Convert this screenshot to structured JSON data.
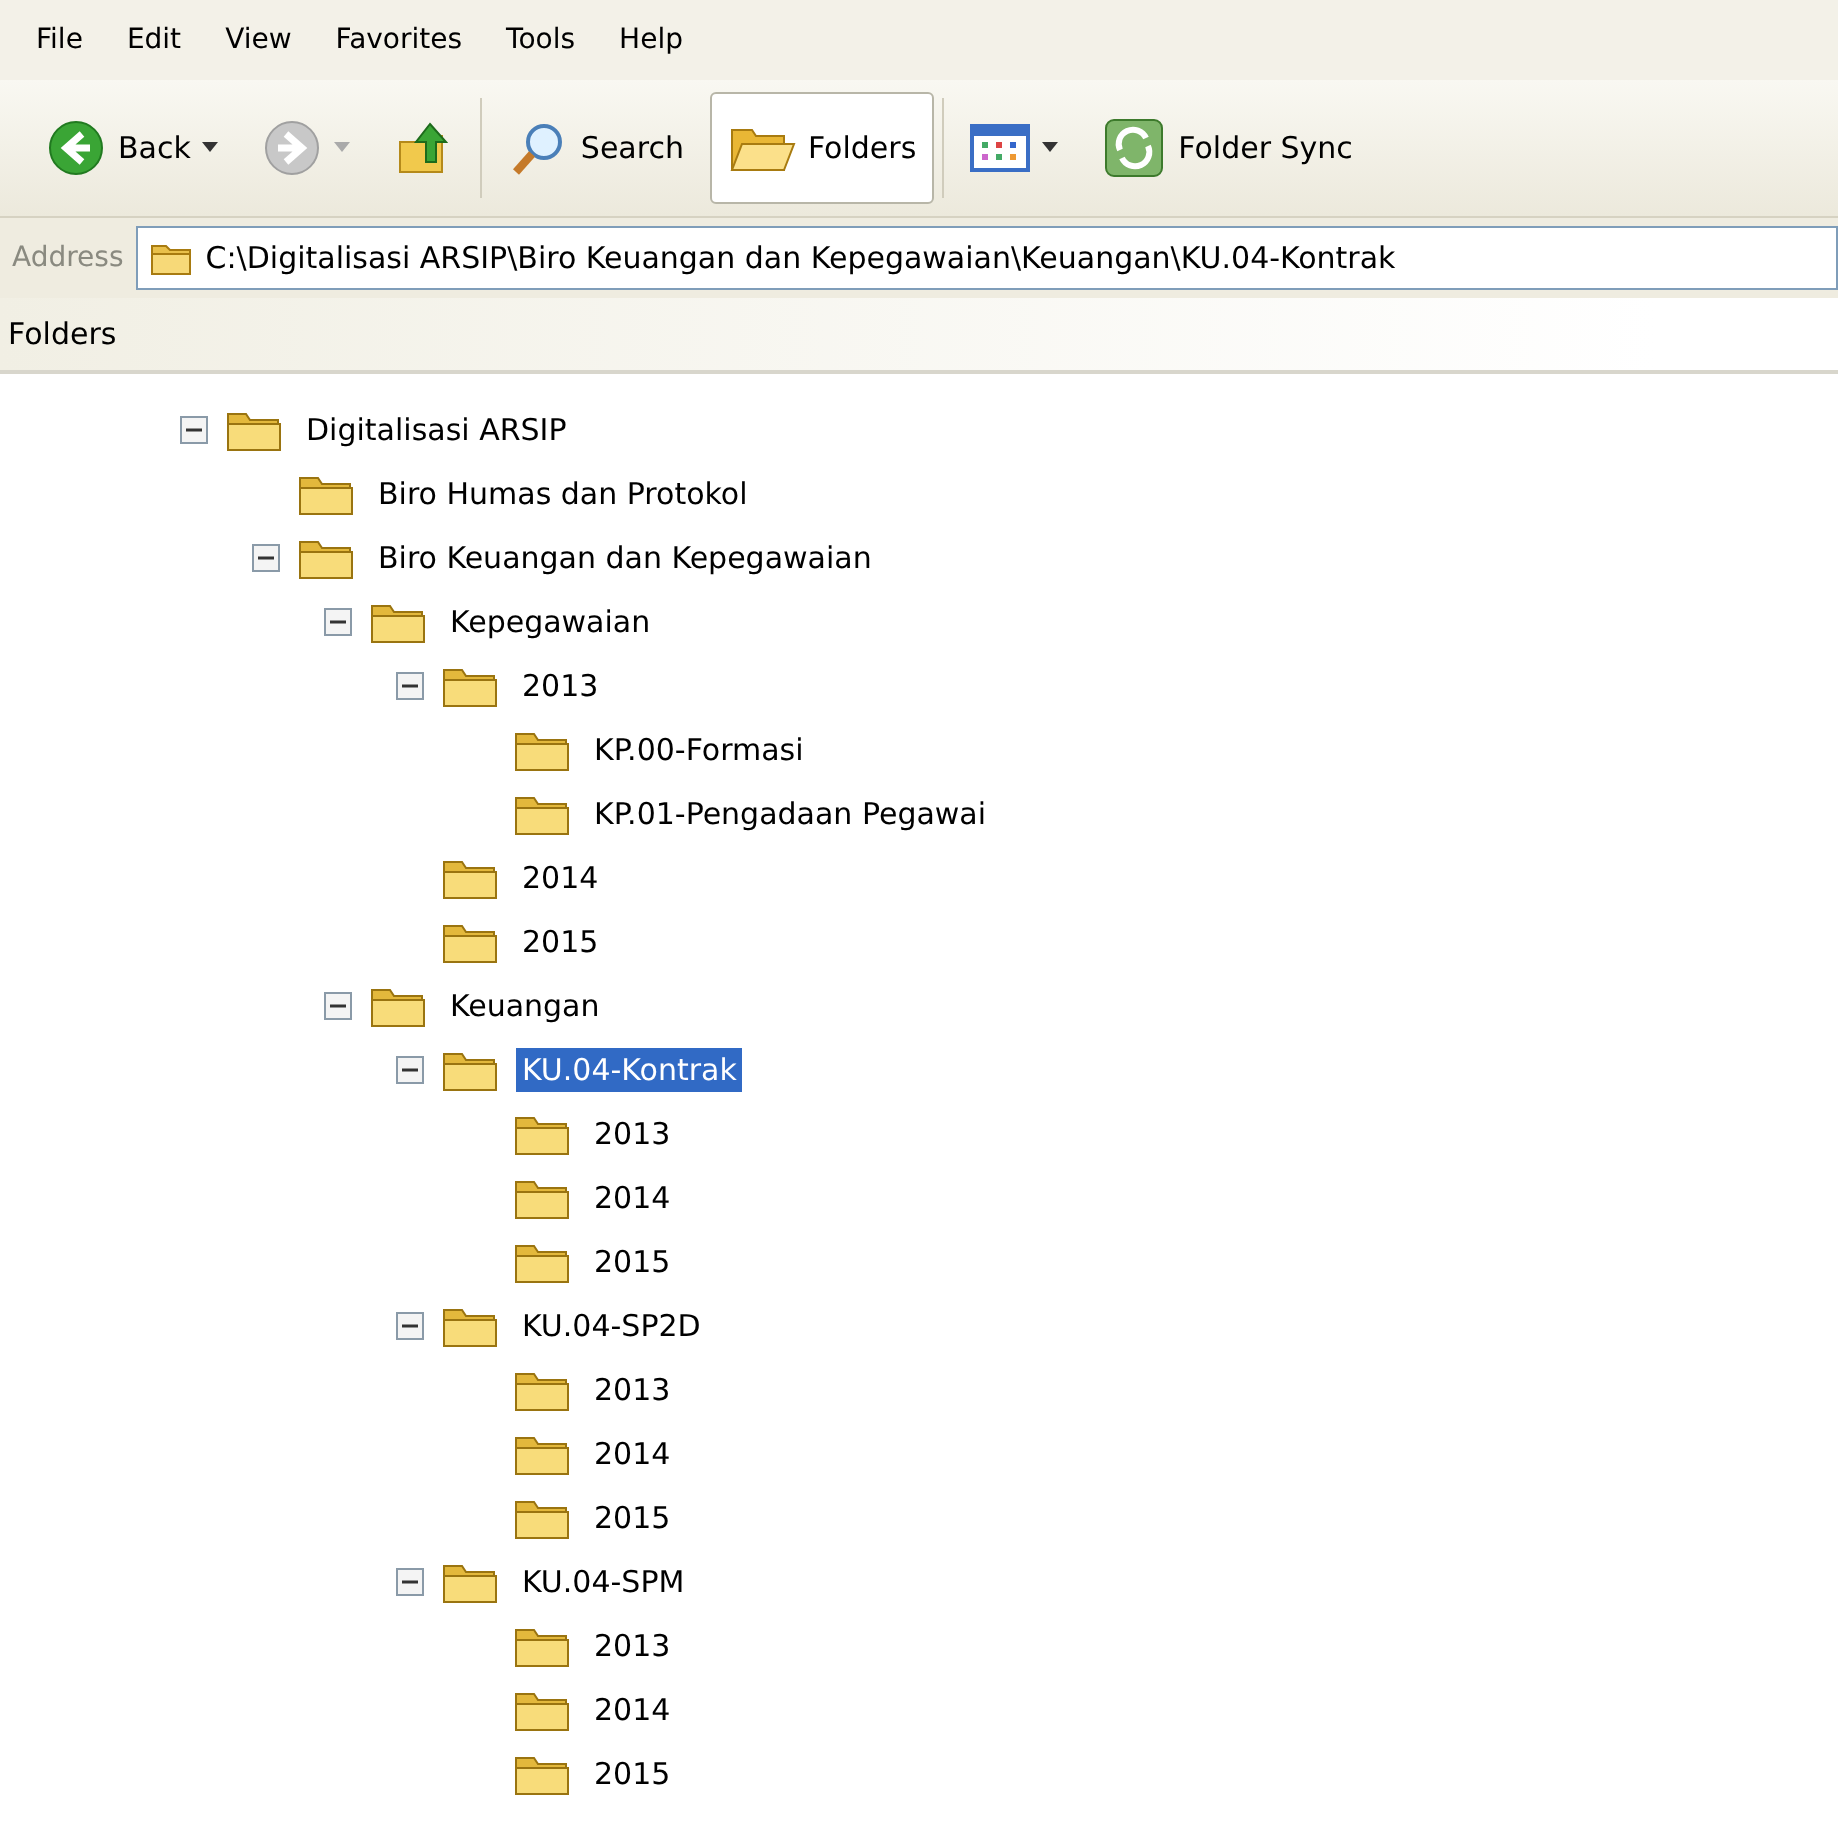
{
  "menu": [
    "File",
    "Edit",
    "View",
    "Favorites",
    "Tools",
    "Help"
  ],
  "toolbar": [
    {
      "kind": "back",
      "label": "Back",
      "disabled": false,
      "selected": false
    },
    {
      "kind": "forward",
      "disabled": true,
      "selected": false
    },
    {
      "kind": "up",
      "disabled": false,
      "selected": false
    },
    {
      "kind": "search",
      "label": "Search",
      "disabled": false,
      "selected": false
    },
    {
      "kind": "folders",
      "label": "Folders",
      "disabled": false,
      "selected": true
    },
    {
      "kind": "views",
      "disabled": false,
      "selected": false
    },
    {
      "kind": "sync",
      "label": "Folder Sync",
      "disabled": false,
      "selected": false
    }
  ],
  "address": {
    "label": "Address",
    "value": "C:\\Digitalisasi ARSIP\\Biro Keuangan dan Kepegawaian\\Keuangan\\KU.04-Kontrak"
  },
  "folders_pane": {
    "title": "Folders",
    "tree": [
      {
        "label": "Digitalisasi ARSIP",
        "expanded": true,
        "selected": false,
        "children": [
          {
            "label": "Biro Humas dan Protokol",
            "selected": false
          },
          {
            "label": "Biro Keuangan dan Kepegawaian",
            "expanded": true,
            "selected": false,
            "children": [
              {
                "label": "Kepegawaian",
                "expanded": true,
                "selected": false,
                "children": [
                  {
                    "label": "2013",
                    "expanded": true,
                    "selected": false,
                    "children": [
                      {
                        "label": "KP.00-Formasi",
                        "selected": false
                      },
                      {
                        "label": "KP.01-Pengadaan Pegawai",
                        "selected": false
                      }
                    ]
                  },
                  {
                    "label": "2014",
                    "selected": false
                  },
                  {
                    "label": "2015",
                    "selected": false
                  }
                ]
              },
              {
                "label": "Keuangan",
                "expanded": true,
                "selected": false,
                "children": [
                  {
                    "label": "KU.04-Kontrak",
                    "expanded": true,
                    "selected": true,
                    "children": [
                      {
                        "label": "2013",
                        "selected": false
                      },
                      {
                        "label": "2014",
                        "selected": false
                      },
                      {
                        "label": "2015",
                        "selected": false
                      }
                    ]
                  },
                  {
                    "label": "KU.04-SP2D",
                    "expanded": true,
                    "selected": false,
                    "children": [
                      {
                        "label": "2013",
                        "selected": false
                      },
                      {
                        "label": "2014",
                        "selected": false
                      },
                      {
                        "label": "2015",
                        "selected": false
                      }
                    ]
                  },
                  {
                    "label": "KU.04-SPM",
                    "expanded": true,
                    "selected": false,
                    "children": [
                      {
                        "label": "2013",
                        "selected": false
                      },
                      {
                        "label": "2014",
                        "selected": false
                      },
                      {
                        "label": "2015",
                        "selected": false
                      }
                    ]
                  }
                ]
              }
            ]
          }
        ]
      }
    ]
  }
}
